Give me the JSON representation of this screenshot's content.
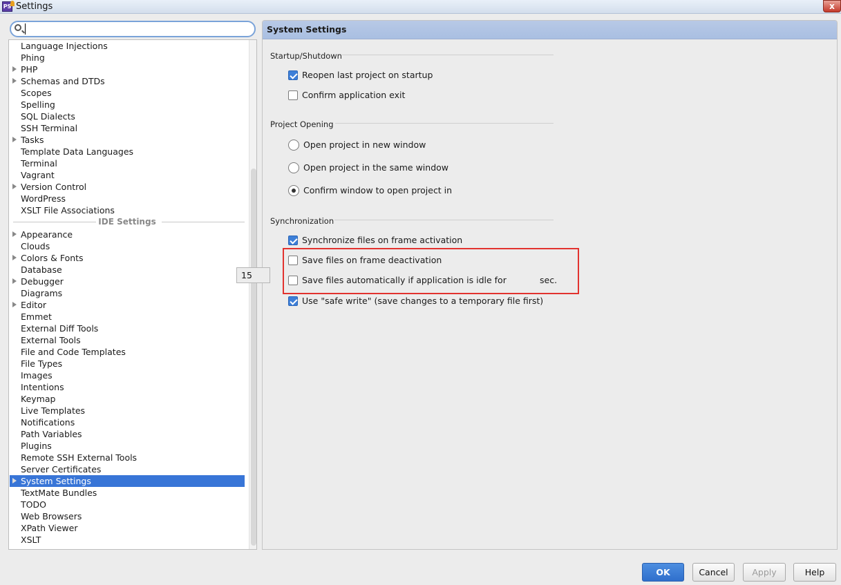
{
  "window": {
    "title": "Settings",
    "app_icon": "PhpStorm-icon",
    "close_glyph": "x"
  },
  "search": {
    "value": "",
    "placeholder": ""
  },
  "tree": {
    "items": [
      {
        "label": "Language Injections",
        "expandable": false
      },
      {
        "label": "Phing",
        "expandable": false
      },
      {
        "label": "PHP",
        "expandable": true
      },
      {
        "label": "Schemas and DTDs",
        "expandable": true
      },
      {
        "label": "Scopes",
        "expandable": false
      },
      {
        "label": "Spelling",
        "expandable": false
      },
      {
        "label": "SQL Dialects",
        "expandable": false
      },
      {
        "label": "SSH Terminal",
        "expandable": false
      },
      {
        "label": "Tasks",
        "expandable": true
      },
      {
        "label": "Template Data Languages",
        "expandable": false
      },
      {
        "label": "Terminal",
        "expandable": false
      },
      {
        "label": "Vagrant",
        "expandable": false
      },
      {
        "label": "Version Control",
        "expandable": true
      },
      {
        "label": "WordPress",
        "expandable": false
      },
      {
        "label": "XSLT File Associations",
        "expandable": false
      }
    ],
    "separator": "IDE Settings",
    "ide_items": [
      {
        "label": "Appearance",
        "expandable": true
      },
      {
        "label": "Clouds",
        "expandable": false
      },
      {
        "label": "Colors & Fonts",
        "expandable": true
      },
      {
        "label": "Database",
        "expandable": false
      },
      {
        "label": "Debugger",
        "expandable": true
      },
      {
        "label": "Diagrams",
        "expandable": false
      },
      {
        "label": "Editor",
        "expandable": true
      },
      {
        "label": "Emmet",
        "expandable": false
      },
      {
        "label": "External Diff Tools",
        "expandable": false
      },
      {
        "label": "External Tools",
        "expandable": false
      },
      {
        "label": "File and Code Templates",
        "expandable": false
      },
      {
        "label": "File Types",
        "expandable": false
      },
      {
        "label": "Images",
        "expandable": false
      },
      {
        "label": "Intentions",
        "expandable": false
      },
      {
        "label": "Keymap",
        "expandable": false
      },
      {
        "label": "Live Templates",
        "expandable": false
      },
      {
        "label": "Notifications",
        "expandable": false
      },
      {
        "label": "Path Variables",
        "expandable": false
      },
      {
        "label": "Plugins",
        "expandable": false
      },
      {
        "label": "Remote SSH External Tools",
        "expandable": false
      },
      {
        "label": "Server Certificates",
        "expandable": false
      },
      {
        "label": "System Settings",
        "expandable": true,
        "selected": true
      },
      {
        "label": "TextMate Bundles",
        "expandable": false
      },
      {
        "label": "TODO",
        "expandable": false
      },
      {
        "label": "Web Browsers",
        "expandable": false
      },
      {
        "label": "XPath Viewer",
        "expandable": false
      },
      {
        "label": "XSLT",
        "expandable": false
      }
    ]
  },
  "panel": {
    "title": "System Settings",
    "startup": {
      "title": "Startup/Shutdown",
      "reopen_label": "Reopen last project on startup",
      "reopen_checked": true,
      "confirm_exit_label": "Confirm application exit",
      "confirm_exit_checked": false
    },
    "project_opening": {
      "title": "Project Opening",
      "options": [
        {
          "label": "Open project in new window",
          "selected": false
        },
        {
          "label": "Open project in the same window",
          "selected": false
        },
        {
          "label": "Confirm window to open project in",
          "selected": true
        }
      ]
    },
    "sync": {
      "title": "Synchronization",
      "sync_label": "Synchronize files on frame activation",
      "sync_checked": true,
      "save_deactivation_label": "Save files on frame deactivation",
      "save_deactivation_checked": false,
      "save_idle_label": "Save files automatically if application is idle for",
      "save_idle_checked": false,
      "idle_seconds": "15",
      "sec_label": "sec.",
      "safe_write_label": "Use \"safe write\" (save changes to a temporary file first)",
      "safe_write_checked": true
    }
  },
  "buttons": {
    "ok": "OK",
    "cancel": "Cancel",
    "apply": "Apply",
    "help": "Help"
  },
  "colors": {
    "selection": "#3875d7",
    "header": "#b8c9e6",
    "checkbox_checked": "#3d7fd8",
    "highlight_box": "#e2322e",
    "ok_button": "#2f6fcc"
  }
}
